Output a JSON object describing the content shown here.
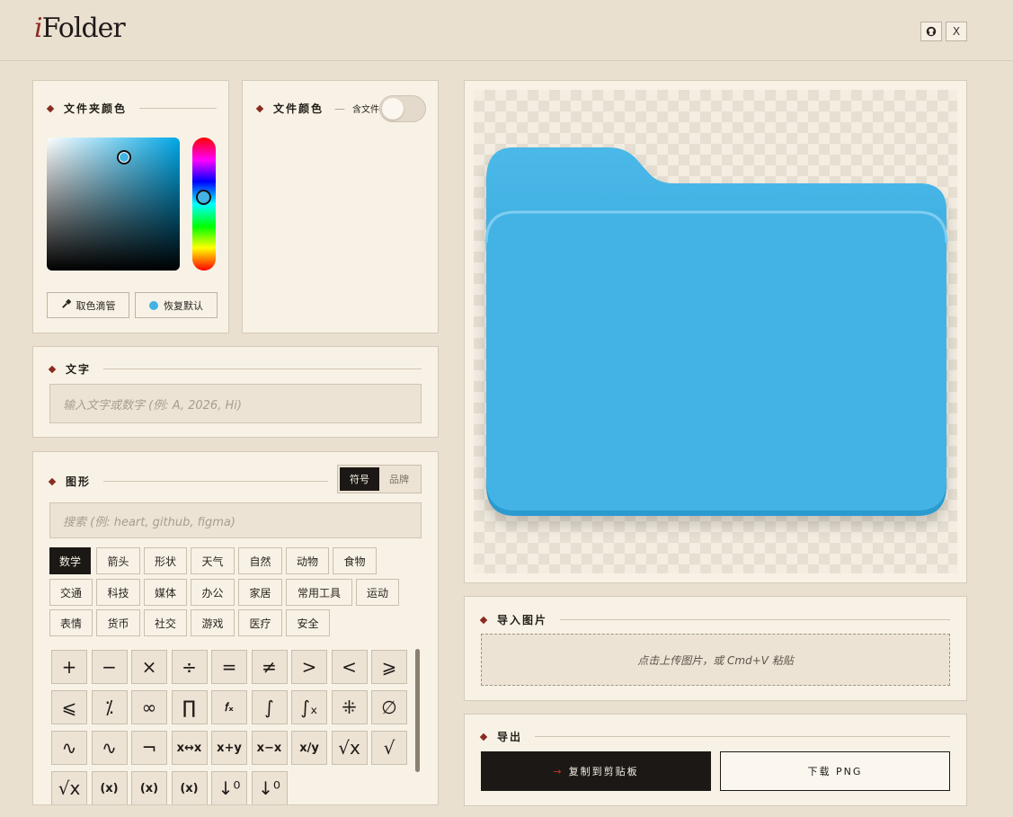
{
  "app": {
    "logo_i": "i",
    "logo_rest": "Folder"
  },
  "header": {
    "github_icon": "github-icon",
    "x_icon": "x-icon",
    "x_glyph": "X"
  },
  "folder_color": {
    "title": "文件夹颜色",
    "eyedropper_label": "取色滴管",
    "reset_label": "恢复默认",
    "current_color": "#43b3e4"
  },
  "file_color": {
    "title": "文件颜色",
    "dash": "—",
    "include_files_label": "含文件",
    "include_files_on": false
  },
  "text_section": {
    "title": "文字",
    "placeholder": "输入文字或数字 (例: A, 2026, Hi)"
  },
  "shape_section": {
    "title": "图形",
    "tabs": [
      "符号",
      "品牌"
    ],
    "active_tab": 0,
    "search_placeholder": "搜索 (例: heart, github, figma)",
    "categories_row1": [
      "数学",
      "箭头",
      "形状",
      "天气",
      "自然",
      "动物",
      "食物"
    ],
    "categories_row2": [
      "交通",
      "科技",
      "媒体",
      "办公",
      "家居",
      "常用工具",
      "运动"
    ],
    "categories_row3": [
      "表情",
      "货币",
      "社交",
      "游戏",
      "医疗",
      "安全"
    ],
    "symbols_row1": [
      "+",
      "−",
      "×",
      "÷",
      "=",
      "≠",
      ">",
      "<",
      "⩾"
    ],
    "symbols_row2": [
      "⩽",
      "⁒",
      "∞",
      "∏",
      "𝑓ₓ",
      "∫",
      "∫ₓ",
      "⁜",
      "∅"
    ],
    "symbols_row3": [
      "∿",
      "∿",
      "¬",
      "x↔x",
      "x+y",
      "x−x",
      "x/y",
      "√x",
      "√"
    ],
    "symbols_row4": [
      "√x",
      "(x)",
      "(x)",
      "(x)",
      "↓⁰",
      "↓⁰"
    ]
  },
  "import_section": {
    "title": "导入图片",
    "dropzone_text": "点击上传图片，或 Cmd+V 粘贴"
  },
  "export_section": {
    "title": "导出",
    "copy_label": "复制到剪贴板",
    "copy_arrow": "→",
    "download_label": "下载 PNG"
  },
  "colors": {
    "accent": "#8b2a1f",
    "folder_front": "#43b3e4",
    "folder_back": "#2fa3d9",
    "background": "#e9e0d0",
    "panel": "#f8f2e6"
  }
}
